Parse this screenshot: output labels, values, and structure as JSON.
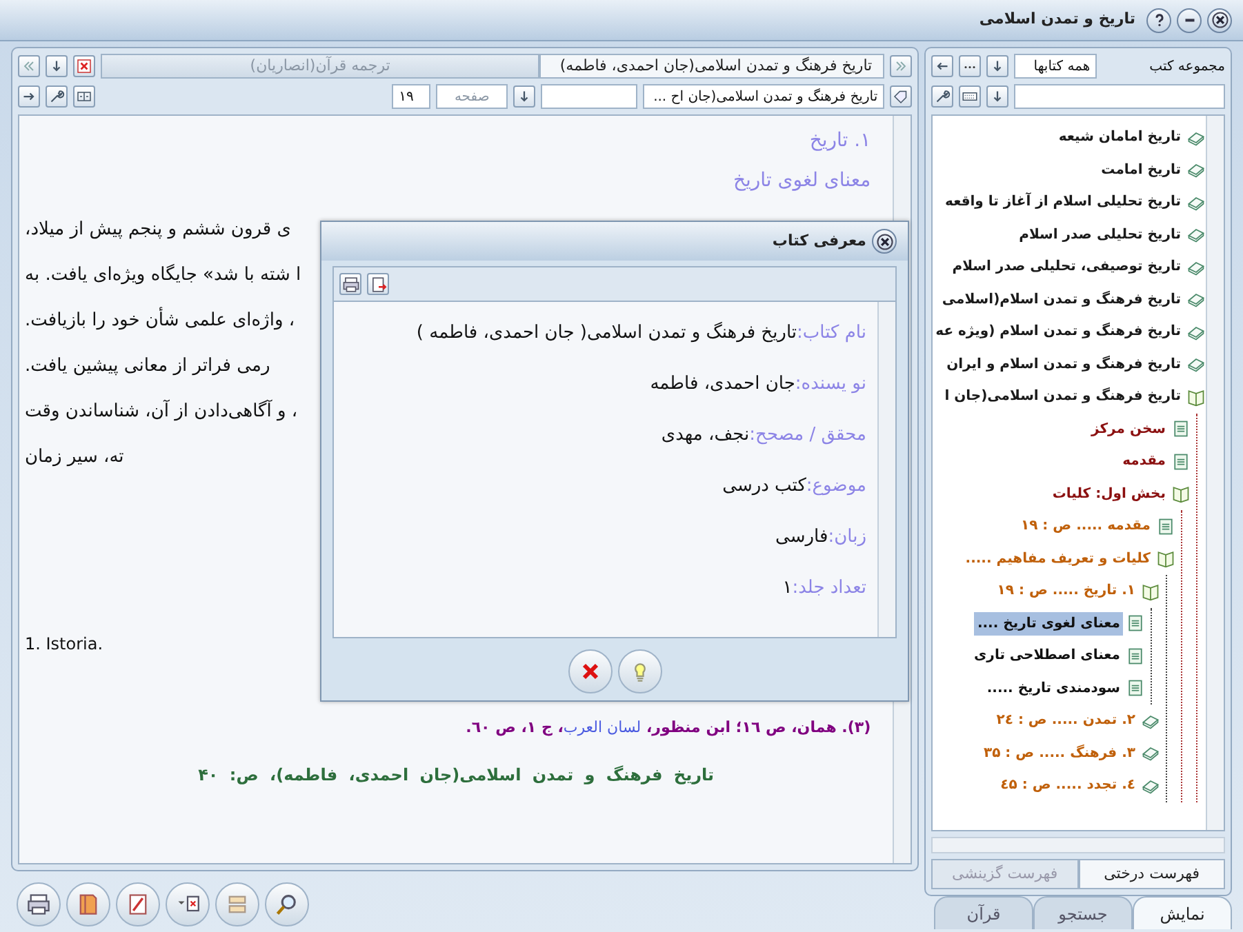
{
  "window": {
    "title": "تاریخ و تمدن اسلامی"
  },
  "reader": {
    "tabs": [
      {
        "label": "تاریخ فرهنگ و تمدن اسلامی(جان احمدی، فاطمه)",
        "selected": true
      },
      {
        "label": "ترجمه قرآن(انصاریان)",
        "selected": false
      }
    ],
    "book_select": {
      "value": "تاریخ فرهنگ و تمدن اسلامی(جان اح ..."
    },
    "page_label": "صفحه",
    "page_field": {
      "value": "۱۹"
    },
    "heading": "۱. تاریخ",
    "subheading": "معنای لغوی تاریخ",
    "paragraph_lines": [
      "ی قرون  ششم و پنجم پیش از میلاد،",
      "ا شته با شد» جایگاه ویژه‌ای یافت. به",
      "، واژه‌ای علمی  شأن خود را بازیافت.",
      "رمی فراتر از معانی پیشین یافت.",
      "، و آگاهی‌دادن از آن،  شناساندن وقت",
      "ته، سیر زمان"
    ],
    "footnote": "1. Istoria.",
    "reference": [
      {
        "kind": "plain",
        "text": "(۳). همان، ص ۱٦؛ ابن منظور، "
      },
      {
        "kind": "title",
        "text": "لسان العرب"
      },
      {
        "kind": "plain",
        "text": "، ج ۱، ص ٦۰."
      }
    ],
    "page_footer": "تاریخ فرهنگ و تمدن اسلامی(جان احمدی، فاطمه)، ص: ۴۰"
  },
  "book_info_dialog": {
    "title": "معرفی کتاب",
    "fields": [
      {
        "label": "نام کتاب:",
        "value": "تاریخ فرهنگ و تمدن اسلامی( جان احمدی، فاطمه )"
      },
      {
        "label": "نو یسنده:",
        "value": "جان احمدی، فاطمه"
      },
      {
        "label": "محقق / مصحح:",
        "value": "نجف، مهدی"
      },
      {
        "label": "موضوع:",
        "value": "کتب درسی"
      },
      {
        "label": "زبان:",
        "value": "فارسی"
      },
      {
        "label": "تعداد جلد:",
        "value": "۱"
      }
    ]
  },
  "library": {
    "label": "مجموعه کتب",
    "collection": {
      "value": "همه کتابها"
    },
    "tree": [
      {
        "label": "تاریخ امامان شیعه",
        "kind": "book",
        "expanded": false,
        "selected": false
      },
      {
        "label": "تاریخ امامت",
        "kind": "book",
        "expanded": false,
        "selected": false
      },
      {
        "label": "تاریخ تحلیلی اسلام از آغاز تا واقعه",
        "kind": "book",
        "expanded": false,
        "selected": false
      },
      {
        "label": "تاریخ تحلیلی صدر اسلام",
        "kind": "book",
        "expanded": false,
        "selected": false
      },
      {
        "label": "تاریخ توصیفی، تحلیلی صدر اسلام",
        "kind": "book",
        "expanded": false,
        "selected": false
      },
      {
        "label": "تاریخ فرهنگ و تمدن اسلام(اسلامی",
        "kind": "book",
        "expanded": false,
        "selected": false
      },
      {
        "label": "تاریخ فرهنگ و تمدن اسلام (ویژه عه",
        "kind": "book",
        "expanded": false,
        "selected": false
      },
      {
        "label": "تاریخ فرهنگ و تمدن اسلام و ایران",
        "kind": "book",
        "expanded": false,
        "selected": false
      },
      {
        "label": "تاریخ فرهنگ و تمدن اسلامی(جان ا",
        "kind": "book",
        "expanded": true,
        "selected": false,
        "children": [
          {
            "label": "سخن مرکز",
            "kind": "page",
            "expanded": false,
            "selected": false
          },
          {
            "label": "مقدمه",
            "kind": "page",
            "expanded": false,
            "selected": false
          },
          {
            "label": "بخش اول: کلیات",
            "kind": "book",
            "expanded": true,
            "selected": false,
            "children": [
              {
                "label": "مقدمه ..... ص : ۱۹",
                "kind": "page",
                "expanded": false,
                "selected": false
              },
              {
                "label": "کلیات و تعریف مفاهیم .....",
                "kind": "book",
                "expanded": true,
                "selected": false,
                "children": [
                  {
                    "label": "۱. تاریخ ..... ص : ۱۹",
                    "kind": "book",
                    "expanded": true,
                    "selected": false,
                    "children": [
                      {
                        "label": "معنای لغوی تاریخ ....",
                        "kind": "page",
                        "expanded": false,
                        "selected": true
                      },
                      {
                        "label": "معنای اصطلاحی تاری",
                        "kind": "page",
                        "expanded": false,
                        "selected": false
                      },
                      {
                        "label": "سودمندی تاریخ .....",
                        "kind": "page",
                        "expanded": false,
                        "selected": false
                      }
                    ]
                  },
                  {
                    "label": "۲. تمدن ..... ص : ۲٤",
                    "kind": "book",
                    "expanded": false,
                    "selected": false
                  },
                  {
                    "label": "۳. فرهنگ ..... ص : ۳۵",
                    "kind": "book",
                    "expanded": false,
                    "selected": false
                  },
                  {
                    "label": "٤. تجدد ..... ص : ٤۵",
                    "kind": "book",
                    "expanded": false,
                    "selected": false
                  }
                ]
              }
            ]
          }
        ]
      }
    ],
    "list_tabs": [
      {
        "label": "فهرست درختی",
        "selected": true
      },
      {
        "label": "فهرست گزینشی",
        "selected": false
      }
    ]
  },
  "nav_tabs": [
    {
      "label": "نمایش",
      "selected": true
    },
    {
      "label": "جستجو",
      "selected": false
    },
    {
      "label": "قرآن",
      "selected": false
    }
  ]
}
